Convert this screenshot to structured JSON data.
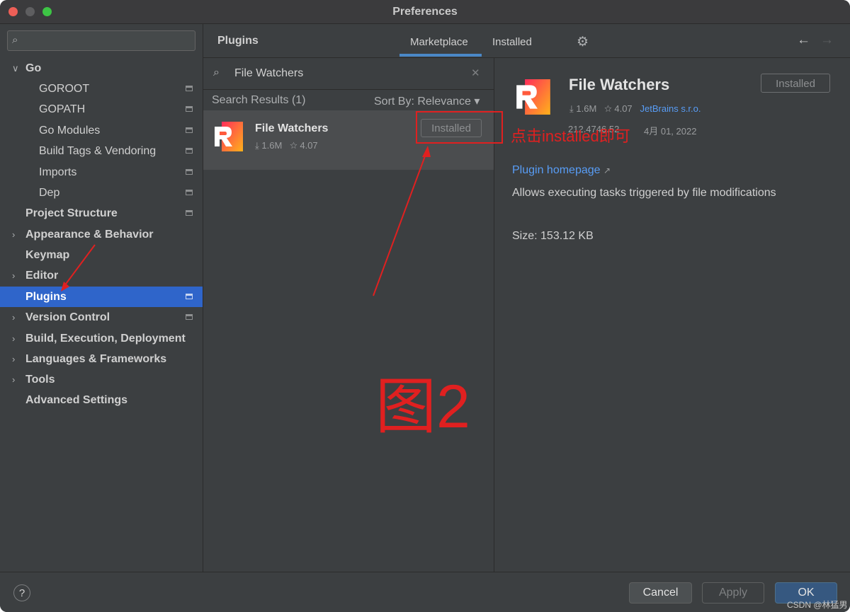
{
  "window": {
    "title": "Preferences"
  },
  "sidebar": {
    "search_placeholder": "",
    "items": [
      {
        "label": "Go",
        "expanded": true
      },
      {
        "label": "GOROOT"
      },
      {
        "label": "GOPATH"
      },
      {
        "label": "Go Modules"
      },
      {
        "label": "Build Tags & Vendoring"
      },
      {
        "label": "Imports"
      },
      {
        "label": "Dep"
      },
      {
        "label": "Project Structure"
      },
      {
        "label": "Appearance & Behavior"
      },
      {
        "label": "Keymap"
      },
      {
        "label": "Editor"
      },
      {
        "label": "Plugins",
        "selected": true
      },
      {
        "label": "Version Control"
      },
      {
        "label": "Build, Execution, Deployment"
      },
      {
        "label": "Languages & Frameworks"
      },
      {
        "label": "Tools"
      },
      {
        "label": "Advanced Settings"
      }
    ]
  },
  "header": {
    "title": "Plugins",
    "tabs": [
      {
        "label": "Marketplace",
        "active": true
      },
      {
        "label": "Installed"
      }
    ]
  },
  "search": {
    "value": "File Watchers"
  },
  "results": {
    "count_label": "Search Results (1)",
    "sort_label": "Sort By: Relevance"
  },
  "plugin": {
    "name": "File Watchers",
    "downloads": "1.6M",
    "rating": "4.07",
    "button_label": "Installed"
  },
  "detail": {
    "name": "File Watchers",
    "downloads": "1.6M",
    "rating": "4.07",
    "vendor": "JetBrains s.r.o.",
    "version": "212.4746.52",
    "date": "4月 01, 2022",
    "button_label": "Installed",
    "homepage_label": "Plugin homepage",
    "description": "Allows executing tasks triggered by file modifications",
    "size": "Size: 153.12 KB"
  },
  "footer": {
    "help_label": "?",
    "cancel_label": "Cancel",
    "apply_label": "Apply",
    "ok_label": "OK"
  },
  "annotations": {
    "hint": "点击installed即可",
    "figure_label": "图2",
    "color": "#e02020"
  },
  "watermark": "CSDN @林猛男",
  "colors": {
    "selection": "#2f65ca",
    "link": "#589df6",
    "tab_underline": "#4a88c7",
    "ok_button": "#365880"
  }
}
